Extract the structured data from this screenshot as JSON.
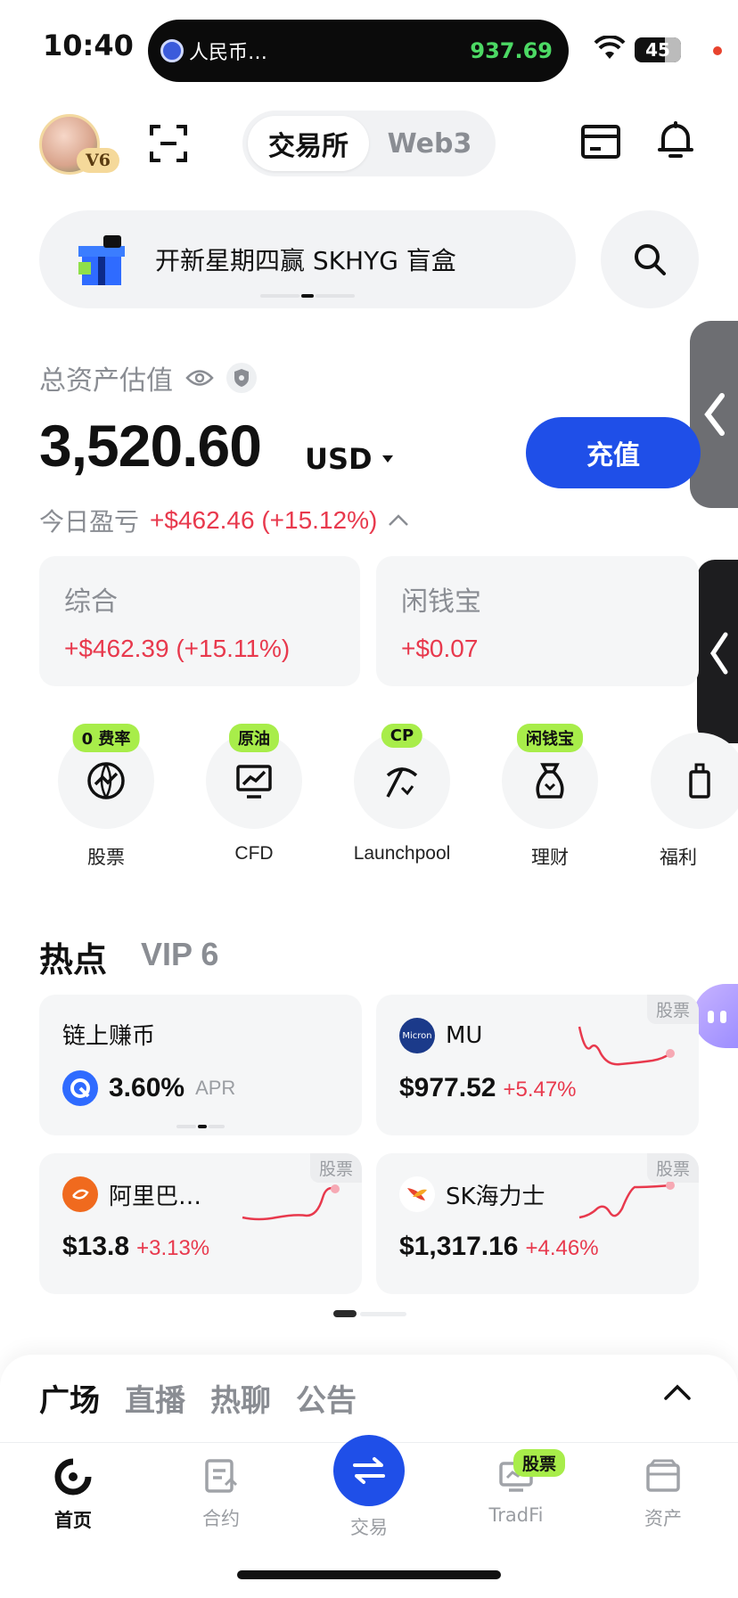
{
  "status_bar": {
    "time": "10:40",
    "island_name": "人民币…",
    "island_price": "937.69",
    "battery": "45"
  },
  "header": {
    "vip_badge": "V6",
    "tabs": [
      {
        "label": "交易所",
        "active": true
      },
      {
        "label": "Web3",
        "active": false
      }
    ]
  },
  "banner": {
    "text": "开新星期四赢 SKHYG 盲盒"
  },
  "assets": {
    "label": "总资产估值",
    "value": "3,520.60",
    "currency": "USD",
    "deposit_label": "充值",
    "pnl_label": "今日盈亏",
    "pnl_value": "+$462.46 (+15.12%)",
    "cards": [
      {
        "title": "综合",
        "value": "+$462.39 (+15.11%)"
      },
      {
        "title": "闲钱宝",
        "value": "+$0.07"
      }
    ]
  },
  "quick_actions": [
    {
      "label": "股票",
      "tag": "0 费率",
      "icon": "globe-chart-icon"
    },
    {
      "label": "CFD",
      "tag": "原油",
      "icon": "monitor-chart-icon"
    },
    {
      "label": "Launchpool",
      "tag": "CP",
      "icon": "pickaxe-icon"
    },
    {
      "label": "理财",
      "tag": "闲钱宝",
      "icon": "money-bag-icon"
    },
    {
      "label": "福利",
      "tag": "",
      "icon": "gift-icon"
    }
  ],
  "hot": {
    "title": "热点",
    "subtitle": "VIP 6",
    "cards": [
      {
        "name": "链上赚币",
        "value": "3.60%",
        "suffix": "APR",
        "tag": ""
      },
      {
        "name": "MU",
        "logo_text": "Micron",
        "price": "$977.52",
        "change": "+5.47%",
        "tag": "股票"
      },
      {
        "name": "阿里巴…",
        "price": "$13.8",
        "change": "+3.13%",
        "tag": "股票"
      },
      {
        "name": "SK海力士",
        "price": "$1,317.16",
        "change": "+4.46%",
        "tag": "股票"
      }
    ]
  },
  "feed_tabs": [
    "广场",
    "直播",
    "热聊",
    "公告"
  ],
  "bottom_nav": [
    {
      "label": "首页",
      "active": true
    },
    {
      "label": "合约",
      "active": false
    },
    {
      "label": "交易",
      "active": false
    },
    {
      "label": "TradFi",
      "active": false,
      "tag": "股票"
    },
    {
      "label": "资产",
      "active": false
    }
  ],
  "colors": {
    "accent": "#1f4fe8",
    "gain": "#e8394d",
    "tag_green": "#a8ed4a"
  }
}
